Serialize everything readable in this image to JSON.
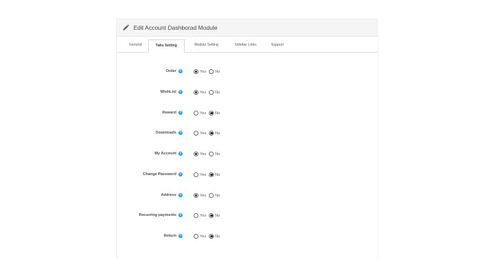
{
  "panel": {
    "title": "Edit Account Dashborad Module",
    "icon": "pencil-icon"
  },
  "tabs": [
    {
      "label": "General",
      "active": false
    },
    {
      "label": "Tabs Setting",
      "active": true
    },
    {
      "label": "Module Setting",
      "active": false
    },
    {
      "label": "Sidebar Links",
      "active": false
    },
    {
      "label": "Support",
      "active": false
    }
  ],
  "options": {
    "yes": "Yes",
    "no": "No"
  },
  "settings": [
    {
      "label": "Order",
      "value": "Yes"
    },
    {
      "label": "WishList",
      "value": "Yes"
    },
    {
      "label": "Reward",
      "value": "No"
    },
    {
      "label": "Downloads",
      "value": "No"
    },
    {
      "label": "My Account",
      "value": "Yes"
    },
    {
      "label": "Change Password",
      "value": "No"
    },
    {
      "label": "Address",
      "value": "Yes"
    },
    {
      "label": "Recurring payments",
      "value": "No"
    },
    {
      "label": "Return",
      "value": "No"
    }
  ],
  "colors": {
    "help_icon": "#2d9fd9",
    "heading_bg": "#f5f5f5"
  }
}
